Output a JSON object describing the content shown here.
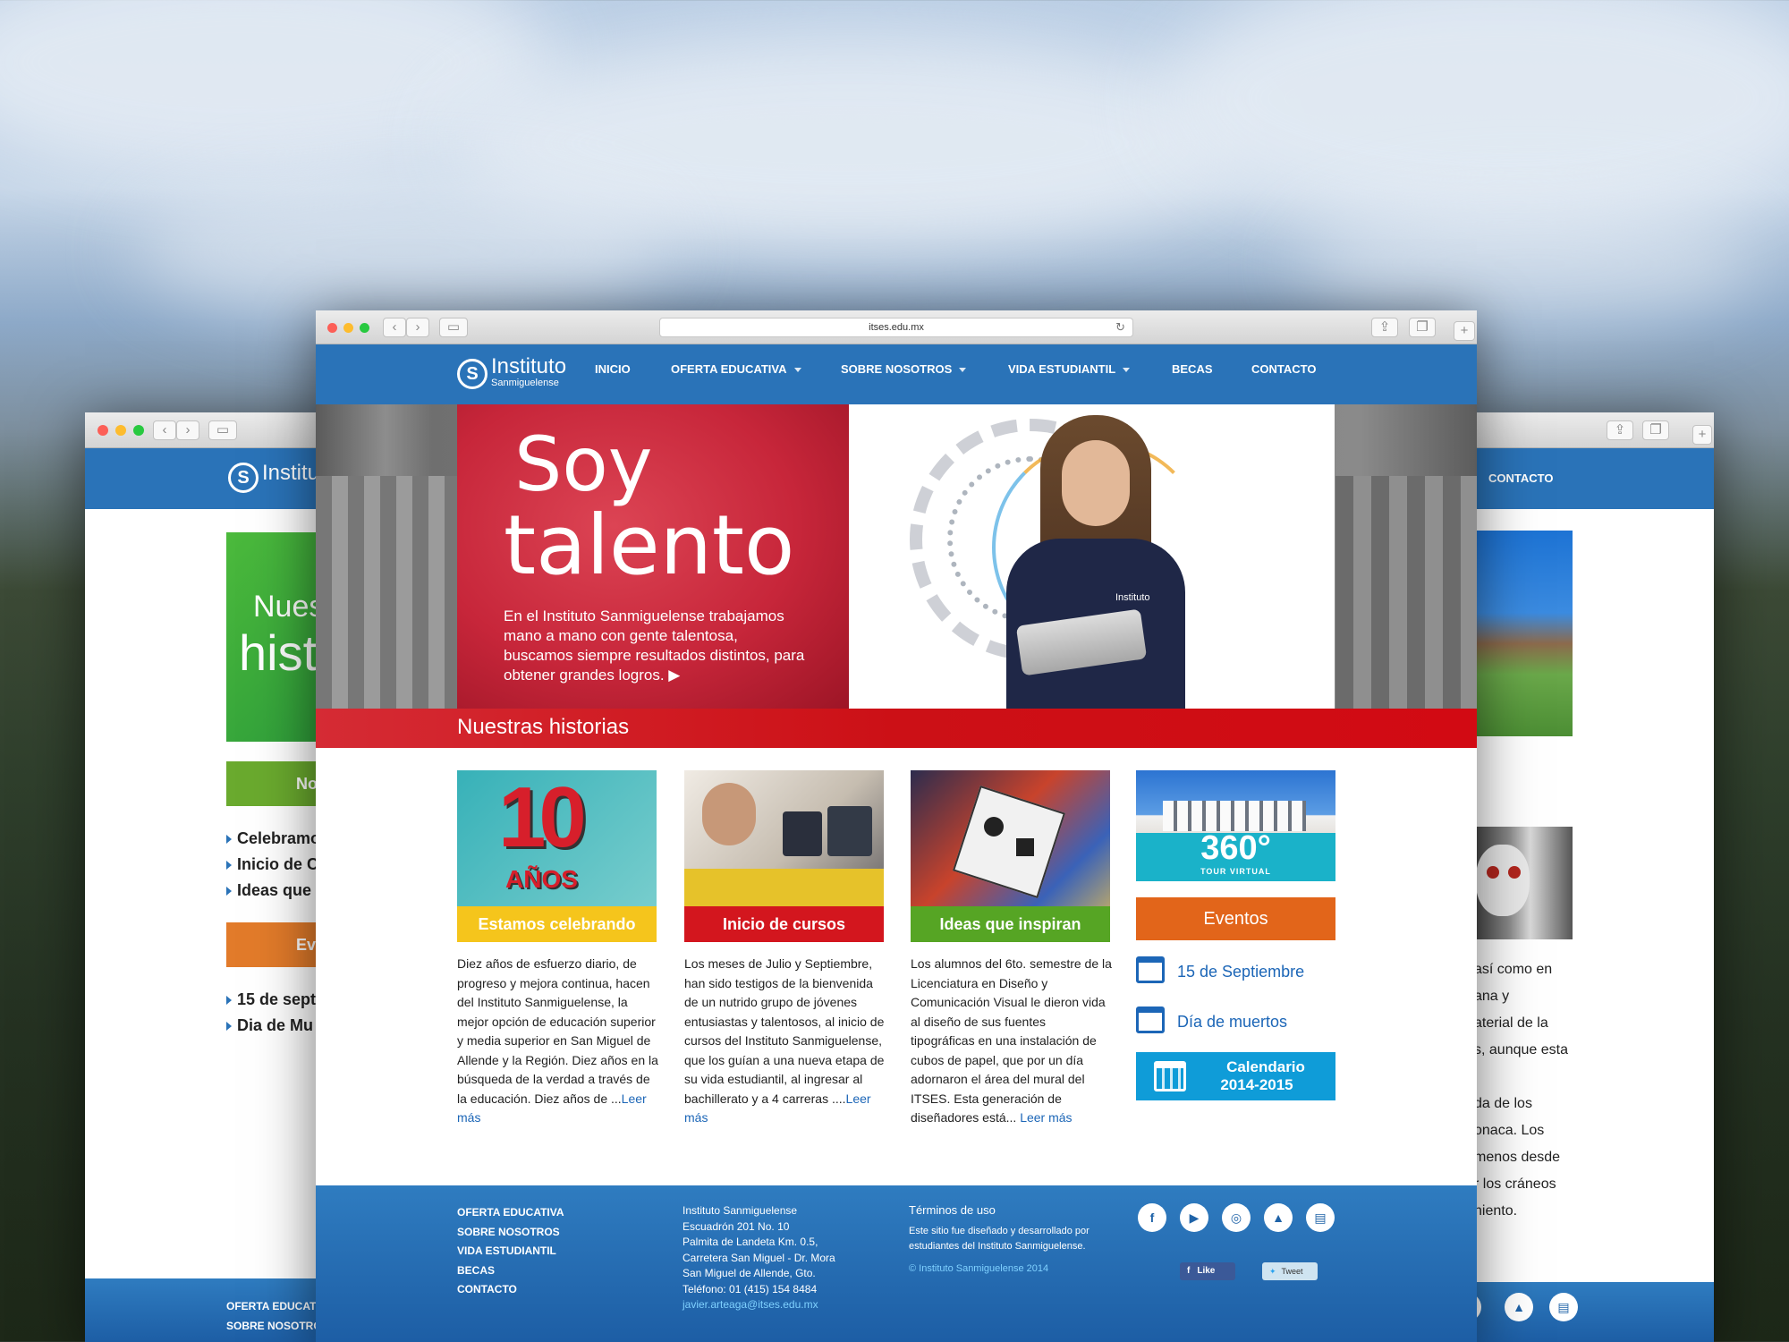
{
  "browser": {
    "url": "itses.edu.mx"
  },
  "logo": {
    "line1": "Instituto",
    "line2": "Sanmiguelense"
  },
  "nav": {
    "items": [
      {
        "label": "INICIO"
      },
      {
        "label": "OFERTA EDUCATIVA"
      },
      {
        "label": "SOBRE NOSOTROS"
      },
      {
        "label": "VIDA ESTUDIANTIL"
      },
      {
        "label": "BECAS"
      },
      {
        "label": "CONTACTO"
      }
    ]
  },
  "hero": {
    "title_line1": "Soy",
    "title_line2": "talento",
    "body": "En el Instituto Sanmiguelense trabajamos mano a mano con gente talentosa, buscamos siempre resultados distintos, para obtener grandes logros.",
    "arrow": "▶",
    "shirt_logo": "Instituto"
  },
  "section": {
    "title": "Nuestras historias"
  },
  "cards": [
    {
      "badge_number": "10",
      "badge_text": "AÑOS",
      "caption": "Estamos celebrando",
      "text": "Diez años de esfuerzo diario, de progreso y mejora continua, hacen del Instituto Sanmiguelense, la mejor opción de educación superior y media superior en San Miguel de Allende y la Región. Diez años en la búsqueda de la verdad a través de la educación. Diez años de ...",
      "link": "Leer más"
    },
    {
      "caption": "Inicio de cursos",
      "text": "Los meses de Julio y Septiembre, han sido testigos de la bienvenida de un nutrido grupo de jóvenes entusiastas y talentosos, al inicio de cursos del Instituto Sanmiguelense, que los guían a una nueva etapa de su vida estudiantil, al ingresar al bachillerato y a 4 carreras ....",
      "link": "Leer más"
    },
    {
      "caption": "Ideas que inspiran",
      "text": "Los alumnos del 6to. semestre de la Licenciatura en Diseño y Comunicación Visual le dieron vida al diseño de sus fuentes tipográficas en una instalación de cubos de papel, que por un día adornaron el área del mural del ITSES. Esta generación de diseñadores está... ",
      "link": "Leer más"
    }
  ],
  "sidebar": {
    "tour_number": "360°",
    "tour_label": "TOUR VIRTUAL",
    "events_title": "Eventos",
    "events": [
      {
        "label": "15 de Septiembre"
      },
      {
        "label": "Día de muertos"
      }
    ],
    "calendar_line1": "Calendario",
    "calendar_line2": "2014-2015"
  },
  "footer": {
    "links": [
      "OFERTA EDUCATIVA",
      "SOBRE NOSOTROS",
      "VIDA ESTUDIANTIL",
      "BECAS",
      "CONTACTO"
    ],
    "address": [
      "Instituto Sanmiguelense",
      "Escuadrón 201 No. 10",
      "Palmita de Landeta Km. 0.5,",
      "Carretera San Miguel - Dr. Mora",
      "San Miguel de Allende, Gto.",
      "Teléfono: 01 (415) 154 8484"
    ],
    "email": "javier.arteaga@itses.edu.mx",
    "terms_title": "Términos de uso",
    "terms_text": "Este sitio fue diseñado y desarrollado por estudiantes del Instituto Sanmiguelense.",
    "copyright": "© Instituto Sanmiguelense 2014",
    "like_label": "Like",
    "tweet_label": "Tweet",
    "social_icons": [
      "facebook-icon",
      "youtube-icon",
      "instagram-icon",
      "graduation-cap-icon",
      "book-icon"
    ]
  },
  "left_window": {
    "banner_text1": "Nues",
    "banner_text2": "hist",
    "green_btn": "No",
    "list": [
      "Celebramo",
      "Inicio de C",
      "Ideas que"
    ],
    "orange_btn": "Ev",
    "events": [
      "15 de sept",
      "Dia de Mu"
    ],
    "footer_links": [
      "OFERTA EDUCATI",
      "SOBRE NOSOTRO"
    ]
  },
  "right_window": {
    "nav_label": "CONTACTO",
    "text_lines": [
      "así como en",
      "ana y",
      "aterial de la",
      "s, aunque esta",
      "",
      "da de los",
      "onaca. Los",
      "menos desde",
      "r los cráneos",
      "niento."
    ]
  },
  "colors": {
    "primary_blue": "#2a73b8",
    "hero_red": "#c9283b",
    "stripe_red": "#d0141e",
    "yellow": "#f5c51c",
    "card_red": "#d3161e",
    "green": "#56a524",
    "orange": "#e2651a",
    "cyan": "#0f9cd8"
  }
}
